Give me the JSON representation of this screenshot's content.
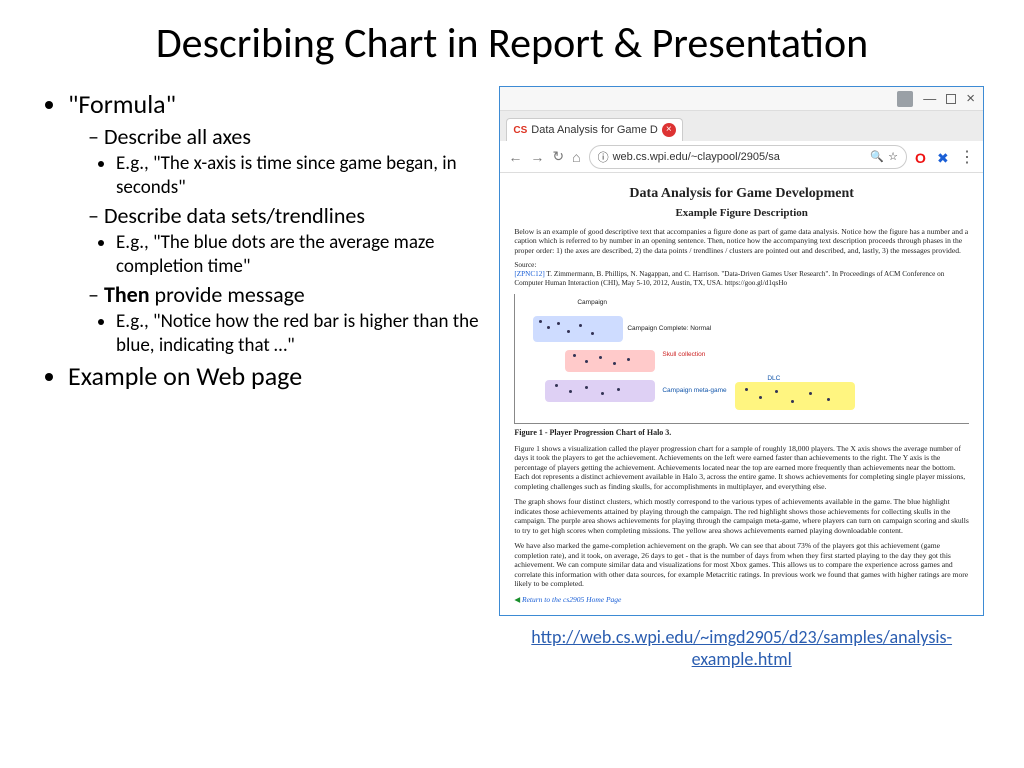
{
  "title": "Describing Chart in Report & Presentation",
  "bullets": {
    "l1a": "\"Formula\"",
    "l2a": "Describe all axes",
    "l3a": "E.g., \"The x-axis is time since game began, in seconds\"",
    "l2b": "Describe data sets/trendlines",
    "l3b": "E.g., \"The blue dots are the average maze completion time\"",
    "l2c_then": "Then",
    "l2c_rest": " provide message",
    "l3c": "E.g., \"Notice how the red bar is higher than the blue, indicating that …\"",
    "l1b": "Example on Web page"
  },
  "browser": {
    "tab_prefix": "CS",
    "tab_title": "Data Analysis for Game D",
    "url": "web.cs.wpi.edu/~claypool/2905/sa",
    "minimize": "—",
    "close": "×"
  },
  "page": {
    "h1": "Data Analysis for Game Development",
    "h2": "Example Figure Description",
    "intro": "Below is an example of good descriptive text that accompanies a figure done as part of game data analysis. Notice how the figure has a number and a caption which is referred to by number in an opening sentence. Then, notice how the accompanying text description proceeds through phases in the proper order: 1) the axes are described, 2) the data points / trendlines / clusters are pointed out and described, and, lastly, 3) the messages provided.",
    "src_label": "Source:",
    "src_ref": "[ZPNC12]",
    "src_rest": " T. Zimmermann, B. Phillips, N. Nagappan, and C. Harrison. \"Data-Driven Games User Research\". In Proceedings of ACM Conference on Computer Human Interaction (CHI), May 5-10, 2012, Austin, TX, USA. https://goo.gl/d1qsHo",
    "chart_labels": {
      "campaign": "Campaign",
      "normal": "Campaign Complete: Normal",
      "skull": "Skull collection",
      "dlc": "DLC",
      "meta": "Campaign meta-game"
    },
    "figcap": "Figure 1 - Player Progression Chart of Halo 3.",
    "para1": "Figure 1 shows a visualization called the player progression chart for a sample of roughly 18,000 players. The X axis shows the average number of days it took the players to get the achievement. Achievements on the left were earned faster than achievements to the right. The Y axis is the percentage of players getting the achievement. Achievements located near the top are earned more frequently than achievements near the bottom. Each dot represents a distinct achievement available in Halo 3, across the entire game. It shows achievements for completing single player missions, completing challenges such as finding skulls, for accomplishments in multiplayer, and everything else.",
    "para2": "The graph shows four distinct clusters, which mostly correspond to the various types of achievements available in the game. The blue highlight indicates those achievements attained by playing through the campaign. The red highlight shows those achievements for collecting skulls in the campaign. The purple area shows achievements for playing through the campaign meta-game, where players can turn on campaign scoring and skulls to try to get high scores when completing missions. The yellow area shows achievements earned playing downloadable content.",
    "para3": "We have also marked the game-completion achievement on the graph. We can see that about 73% of the players got this achievement (game completion rate), and it took, on average, 26 days to get - that is the number of days from when they first started playing to the day they got this achievement. We can compute similar data and visualizations for most Xbox games. This allows us to compare the experience across games and correlate this information with other data sources, for example Metacritic ratings. In previous work we found that games with higher ratings are more likely to be completed.",
    "return": "Return to the cs2905 Home Page"
  },
  "footer_link": "http://web.cs.wpi.edu/~imgd2905/d23/samples/analysis-example.html"
}
